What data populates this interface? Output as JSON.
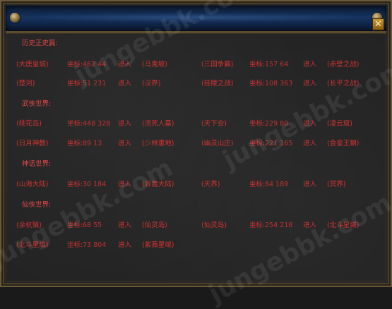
{
  "sections": [
    {
      "title": "历史正史篇:",
      "rows": [
        [
          {
            "name": "(大唐皇城)",
            "coord_label": "坐标:",
            "coord": "462 44",
            "enter": "进入",
            "dest": "(马嵬坡)"
          },
          {
            "name": "(三国争霸)",
            "coord_label": "坐标:",
            "coord": "157 64",
            "enter": "进入",
            "dest": "(赤壁之战)"
          }
        ],
        [
          {
            "name": "(楚河)",
            "coord_label": "坐标:",
            "coord": "51  231",
            "enter": "进入",
            "dest": "(汉界)"
          },
          {
            "name": "(桂陵之战)",
            "coord_label": "坐标:",
            "coord": "108 363",
            "enter": "进入",
            "dest": "(长平之战)"
          }
        ]
      ]
    },
    {
      "title": "武侠世界:",
      "rows": [
        [
          {
            "name": "(桃花岛)",
            "coord_label": "坐标:",
            "coord": "448 328",
            "enter": "进入",
            "dest": "(活死人墓)"
          },
          {
            "name": "(天下会)",
            "coord_label": "坐标:",
            "coord": "229 80",
            "enter": "进入",
            "dest": "(凌云窟)"
          }
        ],
        [
          {
            "name": "(日月神教)",
            "coord_label": "坐标:",
            "coord": "89  13",
            "enter": "进入",
            "dest": "(少林重地)"
          },
          {
            "name": "(幽灵山庄)",
            "coord_label": "坐标:",
            "coord": "221 165",
            "enter": "进入",
            "dest": "(金銮王朝)"
          }
        ]
      ]
    },
    {
      "title": "神话世界:",
      "rows": [
        [
          {
            "name": "(山海大陆)",
            "coord_label": "坐标:",
            "coord": "30 184",
            "enter": "进入",
            "dest": "(异兽大陆)"
          },
          {
            "name": "(天界)",
            "coord_label": "坐标:",
            "coord": "84 189",
            "enter": "进入",
            "dest": "(冥界)"
          }
        ]
      ]
    },
    {
      "title": "仙侠世界:",
      "rows": [
        [
          {
            "name": "(余杭镇)",
            "coord_label": "坐标:",
            "coord": "68 55",
            "enter": "进入",
            "dest": "(仙灵岛)"
          },
          {
            "name": "(仙灵岛)",
            "coord_label": "坐标:",
            "coord": "254 218",
            "enter": "进入",
            "dest": "(北斗星域)"
          }
        ],
        [
          {
            "name": "(北斗星域)",
            "coord_label": "坐标:",
            "coord": "73 804",
            "enter": "进入",
            "dest": "(紫薇星域)"
          }
        ]
      ]
    }
  ],
  "close_label": "✕",
  "watermark": "jungebbk.com"
}
